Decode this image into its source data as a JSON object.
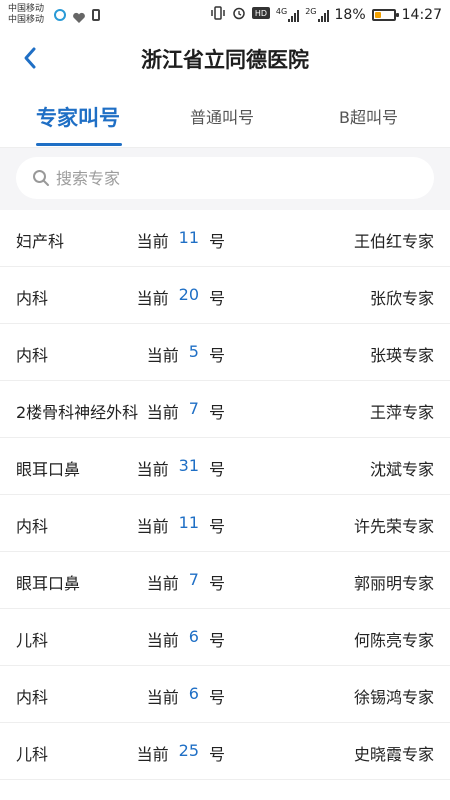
{
  "status_bar": {
    "carrier1": "中国移动",
    "carrier2": "中国移动",
    "network_4g": "4G",
    "network_2g": "2G",
    "battery_text": "18%",
    "time": "14:27",
    "battery_color": "#f2a000"
  },
  "header": {
    "title": "浙江省立同德医院"
  },
  "tabs": [
    {
      "label": "专家叫号",
      "active": true
    },
    {
      "label": "普通叫号",
      "active": false
    },
    {
      "label": "B超叫号",
      "active": false
    }
  ],
  "search": {
    "placeholder": "搜索专家",
    "value": ""
  },
  "list": {
    "current_prefix": "当前",
    "number_suffix": "号",
    "rows": [
      {
        "dept": "妇产科",
        "number": "11",
        "doctor": "王伯红专家"
      },
      {
        "dept": "内科",
        "number": "20",
        "doctor": "张欣专家"
      },
      {
        "dept": "内科",
        "number": "5",
        "doctor": "张瑛专家"
      },
      {
        "dept": "2楼骨科神经外科",
        "number": "7",
        "doctor": "王萍专家"
      },
      {
        "dept": "眼耳口鼻",
        "number": "31",
        "doctor": "沈斌专家"
      },
      {
        "dept": "内科",
        "number": "11",
        "doctor": "许先荣专家"
      },
      {
        "dept": "眼耳口鼻",
        "number": "7",
        "doctor": "郭丽明专家"
      },
      {
        "dept": "儿科",
        "number": "6",
        "doctor": "何陈亮专家"
      },
      {
        "dept": "内科",
        "number": "6",
        "doctor": "徐锡鸿专家"
      },
      {
        "dept": "儿科",
        "number": "25",
        "doctor": "史晓霞专家"
      }
    ]
  },
  "colors": {
    "accent": "#1f6fc5",
    "background": "#f5f5f7"
  }
}
